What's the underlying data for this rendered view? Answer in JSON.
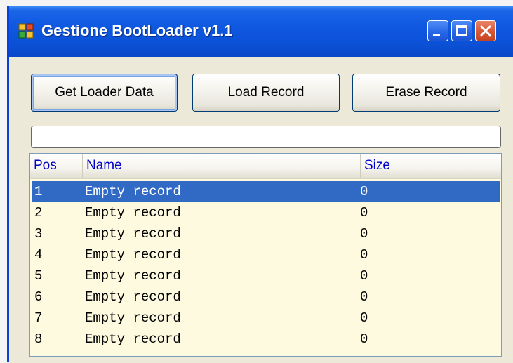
{
  "window": {
    "title": "Gestione BootLoader v1.1"
  },
  "toolbar": {
    "get_loader_data_label": "Get Loader Data",
    "load_record_label": "Load Record",
    "erase_record_label": "Erase Record"
  },
  "progress": {
    "value": 0
  },
  "records_table": {
    "columns": [
      "Pos",
      "Name",
      "Size"
    ],
    "selected_index": 0,
    "rows": [
      {
        "pos": "1",
        "name": "Empty record",
        "size": "0"
      },
      {
        "pos": "2",
        "name": "Empty record",
        "size": "0"
      },
      {
        "pos": "3",
        "name": "Empty record",
        "size": "0"
      },
      {
        "pos": "4",
        "name": "Empty record",
        "size": "0"
      },
      {
        "pos": "5",
        "name": "Empty record",
        "size": "0"
      },
      {
        "pos": "6",
        "name": "Empty record",
        "size": "0"
      },
      {
        "pos": "7",
        "name": "Empty record",
        "size": "0"
      },
      {
        "pos": "8",
        "name": "Empty record",
        "size": "0"
      }
    ]
  },
  "icons": {
    "app": "application-icon",
    "minimize": "minimize-icon",
    "maximize": "maximize-icon",
    "close": "close-icon"
  },
  "colors": {
    "titlebar": "#0b52d8",
    "selection": "#316ac5",
    "list_background": "#fdfae0",
    "header_text": "#0000cc",
    "close_button": "#d85a38"
  }
}
